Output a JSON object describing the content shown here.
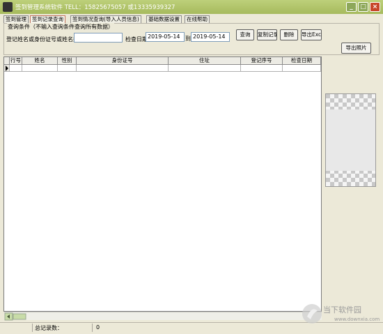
{
  "window": {
    "title": "签到管理系统软件 TELL：15825675057 或13335939327"
  },
  "tabs": [
    {
      "label": "签到管理"
    },
    {
      "label": "签到记录查询"
    },
    {
      "label": "签到情况查询(导入人员信息)"
    },
    {
      "label": "基础数据设置"
    },
    {
      "label": "在线帮助"
    }
  ],
  "active_tab": 1,
  "query": {
    "group_label": "查询条件（不输入查询条件查询所有数据）",
    "name_id_label": "登记姓名或身份证号或姓名拼",
    "name_id_value": "",
    "date_label": "检查日期",
    "date_from": "2019-05-14",
    "date_to_label": "到",
    "date_to": "2019-05-14"
  },
  "buttons": {
    "query": "查询",
    "copy": "复制记录",
    "delete": "删除",
    "export_excel": "导出Excel",
    "export_photo": "导出照片"
  },
  "table": {
    "columns": [
      "行号",
      "姓名",
      "性别",
      "身份证号",
      "住址",
      "登记序号",
      "检查日期"
    ],
    "rows": []
  },
  "status": {
    "total_label": "总记录数：",
    "total_value": "0"
  },
  "watermark": {
    "text": "当下软件园",
    "url": "www.downxia.com"
  },
  "colors": {
    "titlebar": "#a6ba5d",
    "close_button": "#c8452a"
  }
}
